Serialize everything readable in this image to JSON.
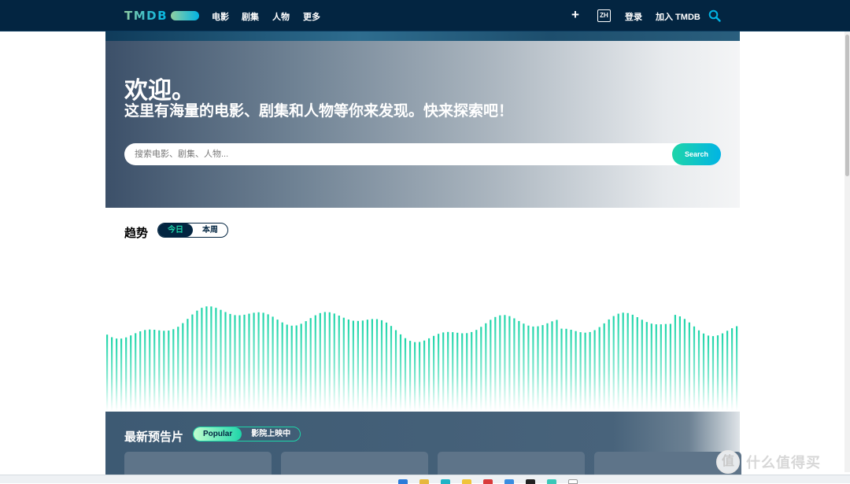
{
  "nav": {
    "logo": "TMDB",
    "items": [
      "电影",
      "剧集",
      "人物",
      "更多"
    ],
    "plus": "+",
    "lang": "ZH",
    "login": "登录",
    "join": "加入 TMDB"
  },
  "hero": {
    "title": "欢迎。",
    "subtitle": "这里有海量的电影、剧集和人物等你来发现。快来探索吧！",
    "search_placeholder": "搜索电影、剧集、人物...",
    "search_button": "Search"
  },
  "trending": {
    "title": "趋势",
    "tabs": [
      "今日",
      "本周"
    ],
    "active_tab": 0
  },
  "trailers": {
    "title": "最新预告片",
    "tabs": [
      "Popular",
      "影院上映中"
    ],
    "active_tab": 0
  },
  "watermark": {
    "logo": "值",
    "text": "什么值得买"
  },
  "colors": {
    "nav_bg": "#032541",
    "accent_green": "#1ed5a9",
    "accent_blue": "#01b4e4"
  },
  "icons": {
    "search": "search-icon",
    "plus": "plus-icon",
    "language": "language-badge"
  }
}
